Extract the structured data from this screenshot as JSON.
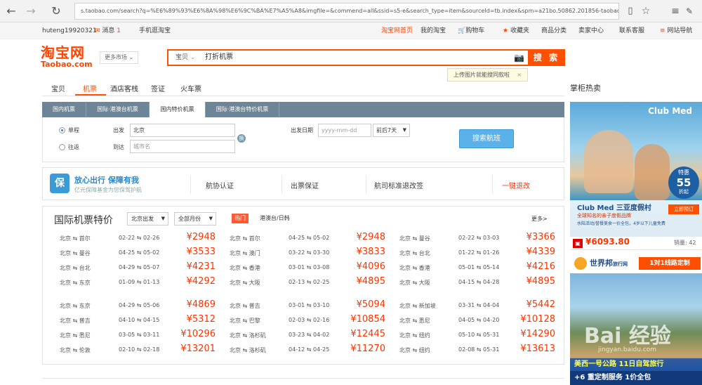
{
  "browser": {
    "url": "s.taobao.com/search?q=%E6%89%93%E6%8A%98%E6%9C%BA%E7%A5%A8&imgfile=&commend=all&ssid=s5-e&search_type=item&sourceId=tb.index&spm=a21bo.50862.201856-taobao-item"
  },
  "topbar": {
    "user": "huteng19920321",
    "messages_label": "消息",
    "messages_count": "1",
    "mobile": "手机逛淘宝",
    "home": "淘宝网首页",
    "my_taobao": "我的淘宝",
    "cart": "购物车",
    "favorites": "收藏夹",
    "categories": "商品分类",
    "seller": "卖家中心",
    "service": "联系客服",
    "sitenav": "网站导航"
  },
  "header": {
    "logo_cn": "淘宝网",
    "logo_en": "Taobao.com",
    "market": "更多市场",
    "search_type": "宝贝",
    "search_value": "打折机票",
    "search_button": "搜 索",
    "tip": "上传图片就能搜同款啦"
  },
  "tabs": [
    "宝贝",
    "机票",
    "酒店客栈",
    "签证",
    "火车票"
  ],
  "subtabs": [
    "国内机票",
    "国际·港澳台机票",
    "国内特价机票",
    "国际·港澳台特价机票"
  ],
  "form": {
    "oneway": "单程",
    "roundtrip": "往返",
    "from_label": "出发",
    "from_value": "北京",
    "to_label": "到达",
    "to_placeholder": "城市名",
    "date_label": "出发日期",
    "date_placeholder": "yyyy-mm-dd",
    "range": "前后7天",
    "search_button": "搜索航班"
  },
  "insurance": {
    "title": "放心出行 保障有我",
    "subtitle": "亿元保障基金为您保驾护航",
    "item1": "航协认证",
    "item2": "出票保证",
    "item3": "航司标准退改签",
    "item4": "一键退改"
  },
  "deals": {
    "title": "国际机票特价",
    "origin": "北京出发",
    "month": "全部月份",
    "hot": "热门",
    "region": "港澳台/日韩",
    "more": "更多>",
    "rows1": [
      [
        [
          "北京 ⇆ 首尔",
          "02-22 ⇆ 02-26",
          "¥2948"
        ],
        [
          "北京 ⇆ 首尔",
          "04-25 ⇆ 05-02",
          "¥2948"
        ],
        [
          "北京 ⇆ 曼谷",
          "02-22 ⇆ 03-03",
          "¥3366"
        ]
      ],
      [
        [
          "北京 ⇆ 曼谷",
          "04-25 ⇆ 05-02",
          "¥3533"
        ],
        [
          "北京 ⇆ 澳门",
          "03-22 ⇆ 03-30",
          "¥3833"
        ],
        [
          "北京 ⇆ 台北",
          "01-22 ⇆ 01-26",
          "¥4339"
        ]
      ],
      [
        [
          "北京 ⇆ 台北",
          "04-29 ⇆ 05-07",
          "¥4231"
        ],
        [
          "北京 ⇆ 香港",
          "03-01 ⇆ 03-08",
          "¥4096"
        ],
        [
          "北京 ⇆ 香港",
          "05-01 ⇆ 05-14",
          "¥4216"
        ]
      ],
      [
        [
          "北京 ⇆ 东京",
          "01-09 ⇆ 01-13",
          "¥4292"
        ],
        [
          "北京 ⇆ 大阪",
          "02-13 ⇆ 02-25",
          "¥4895"
        ],
        [
          "北京 ⇆ 大阪",
          "04-15 ⇆ 04-28",
          "¥4895"
        ]
      ]
    ],
    "rows2": [
      [
        [
          "北京 ⇆ 东京",
          "04-29 ⇆ 05-06",
          "¥4869"
        ],
        [
          "北京 ⇆ 普吉",
          "03-01 ⇆ 03-10",
          "¥5094"
        ],
        [
          "北京 ⇆ 新加坡",
          "03-31 ⇆ 04-04",
          "¥5442"
        ]
      ],
      [
        [
          "北京 ⇆ 普吉",
          "04-10 ⇆ 04-15",
          "¥5312"
        ],
        [
          "北京 ⇆ 巴黎",
          "02-03 ⇆ 02-16",
          "¥10854"
        ],
        [
          "北京 ⇆ 悉尼",
          "04-05 ⇆ 04-20",
          "¥10128"
        ]
      ],
      [
        [
          "北京 ⇆ 悉尼",
          "03-05 ⇆ 03-11",
          "¥10296"
        ],
        [
          "北京 ⇆ 洛杉矶",
          "03-23 ⇆ 04-02",
          "¥12445"
        ],
        [
          "北京 ⇆ 纽约",
          "05-10 ⇆ 05-31",
          "¥14290"
        ]
      ],
      [
        [
          "北京 ⇆ 伦敦",
          "02-10 ⇆ 02-18",
          "¥13201"
        ],
        [
          "北京 ⇆ 洛杉矶",
          "04-12 ⇆ 04-25",
          "¥11270"
        ],
        [
          "北京 ⇆ 纽约",
          "02-08 ⇆ 05-31",
          "¥13613"
        ]
      ]
    ]
  },
  "sidebar": {
    "title": "掌柜热卖",
    "ad1": {
      "brand": "Club Med",
      "badge_top": "特惠",
      "badge_main": "55",
      "badge_unit": "折起",
      "headline": "Club Med 三亚度假村",
      "sub1": "全球知名的亲子度假品牌",
      "sub2": "水陆活动/誉餐美食一价全包，4岁以下儿童免费",
      "book": "立即预订",
      "price": "¥6093.80",
      "sales_label": "销量:",
      "sales": "42"
    },
    "ad2": {
      "brand": "世界邦",
      "brand_sub": "旅行网",
      "slogan": "1对1线路定制",
      "bottom1": "美西一号公路 11日自驾旅行",
      "bottom2": "+6 重定制服务 1价全包"
    },
    "watermark": "Bai 经验",
    "watermark_sub": "jingyan.baidu.com"
  }
}
